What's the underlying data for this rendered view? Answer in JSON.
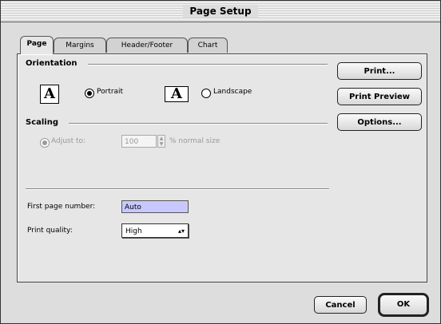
{
  "window": {
    "title": "Page Setup"
  },
  "tabs": [
    {
      "label": "Page",
      "active": true
    },
    {
      "label": "Margins",
      "active": false
    },
    {
      "label": "Header/Footer",
      "active": false
    },
    {
      "label": "Chart",
      "active": false
    }
  ],
  "orientation": {
    "group_label": "Orientation",
    "portrait_icon": "A",
    "landscape_icon": "A",
    "portrait_label": "Portrait",
    "landscape_label": "Landscape",
    "selected": "portrait"
  },
  "scaling": {
    "group_label": "Scaling",
    "adjust_label": "Adjust to:",
    "value": "100",
    "suffix": "% normal size",
    "enabled": false
  },
  "first_page_number": {
    "label": "First page number:",
    "value": "Auto"
  },
  "print_quality": {
    "label": "Print quality:",
    "value": "High"
  },
  "side_buttons": {
    "print": "Print...",
    "print_preview": "Print Preview",
    "options": "Options..."
  },
  "footer_buttons": {
    "cancel": "Cancel",
    "ok": "OK"
  },
  "icons": {
    "stepper": "stepper-arrows-icon",
    "popup_arrow": "updown-arrow-icon"
  }
}
